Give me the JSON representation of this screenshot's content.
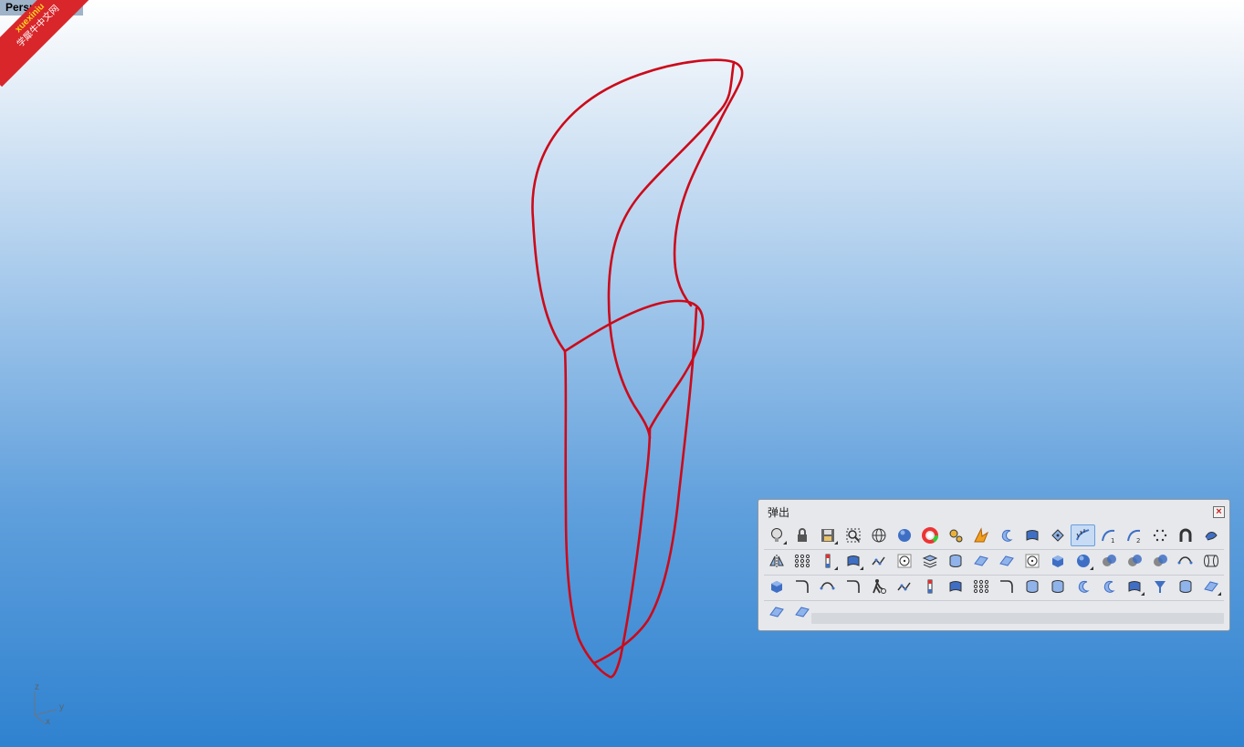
{
  "viewport": {
    "label": "Perspective",
    "axes": {
      "z": "z",
      "y": "y",
      "x": "x"
    }
  },
  "watermark": {
    "line1": "xuexiniu",
    "line2": "学犀牛中文网"
  },
  "curve_color": "#cc0a1a",
  "palette": {
    "title": "弹出",
    "close_label": "×",
    "rows": [
      [
        {
          "icon": "light-bulb-icon",
          "flyout": true
        },
        {
          "icon": "lock-icon",
          "flyout": false
        },
        {
          "icon": "save-icon",
          "flyout": true
        },
        {
          "icon": "zoom-extents-icon",
          "flyout": false
        },
        {
          "icon": "wireframe-sphere-icon",
          "flyout": false
        },
        {
          "icon": "rendered-sphere-icon",
          "flyout": false
        },
        {
          "icon": "color-wheel-icon",
          "flyout": false
        },
        {
          "icon": "gears-icon",
          "flyout": false
        },
        {
          "icon": "render-burst-icon",
          "flyout": false
        },
        {
          "icon": "revolve-icon",
          "flyout": false
        },
        {
          "icon": "surface-patch-icon",
          "flyout": false
        },
        {
          "icon": "points-on-icon",
          "flyout": false
        },
        {
          "icon": "curvature-graph-icon",
          "flyout": false,
          "active": true
        },
        {
          "icon": "arc-degree-1-icon",
          "flyout": false
        },
        {
          "icon": "arc-degree-2-icon",
          "flyout": false
        },
        {
          "icon": "point-cloud-icon",
          "flyout": false
        },
        {
          "icon": "magnet-icon",
          "flyout": false
        },
        {
          "icon": "twist-icon",
          "flyout": false
        }
      ],
      [
        {
          "icon": "mirror-icon",
          "flyout": false
        },
        {
          "icon": "control-points-icon",
          "flyout": false
        },
        {
          "icon": "gumball-icon",
          "flyout": true
        },
        {
          "icon": "surface-edit-icon",
          "flyout": true
        },
        {
          "icon": "polyline-icon",
          "flyout": false
        },
        {
          "icon": "circle-center-icon",
          "flyout": false
        },
        {
          "icon": "layers-icon",
          "flyout": false
        },
        {
          "icon": "cylinder-surface-icon",
          "flyout": false
        },
        {
          "icon": "planar-surface-icon",
          "flyout": false
        },
        {
          "icon": "plane-icon",
          "flyout": false
        },
        {
          "icon": "circle-point-icon",
          "flyout": false
        },
        {
          "icon": "box-solid-icon",
          "flyout": false
        },
        {
          "icon": "sphere-solid-icon",
          "flyout": true
        },
        {
          "icon": "boolean-union-icon",
          "flyout": false
        },
        {
          "icon": "boolean-difference-icon",
          "flyout": false
        },
        {
          "icon": "boolean-intersection-icon",
          "flyout": false
        },
        {
          "icon": "blend-curve-icon",
          "flyout": false
        },
        {
          "icon": "pipe-icon",
          "flyout": false
        }
      ],
      [
        {
          "icon": "box-icon",
          "flyout": false
        },
        {
          "icon": "fillet-curve-icon",
          "flyout": false
        },
        {
          "icon": "curve-blend-icon",
          "flyout": false
        },
        {
          "icon": "arc-curve-icon",
          "flyout": false
        },
        {
          "icon": "walk-mode-icon",
          "flyout": false
        },
        {
          "icon": "polyline-2-icon",
          "flyout": false
        },
        {
          "icon": "gumball-vertical-icon",
          "flyout": false
        },
        {
          "icon": "extrude-surface-icon",
          "flyout": false
        },
        {
          "icon": "array-icon",
          "flyout": false
        },
        {
          "icon": "sweep-icon",
          "flyout": false
        },
        {
          "icon": "cylinder-icon",
          "flyout": false
        },
        {
          "icon": "cylinder-solid-icon",
          "flyout": false
        },
        {
          "icon": "revolve-2-icon",
          "flyout": false
        },
        {
          "icon": "revolve-3-icon",
          "flyout": false
        },
        {
          "icon": "surface-edit-2-icon",
          "flyout": true
        },
        {
          "icon": "funnel-icon",
          "flyout": false
        },
        {
          "icon": "cylinder-2-icon",
          "flyout": false
        },
        {
          "icon": "planar-surface-2-icon",
          "flyout": true
        }
      ],
      [
        {
          "icon": "loft-icon",
          "flyout": false
        },
        {
          "icon": "plane-2-icon",
          "flyout": false
        }
      ]
    ]
  }
}
